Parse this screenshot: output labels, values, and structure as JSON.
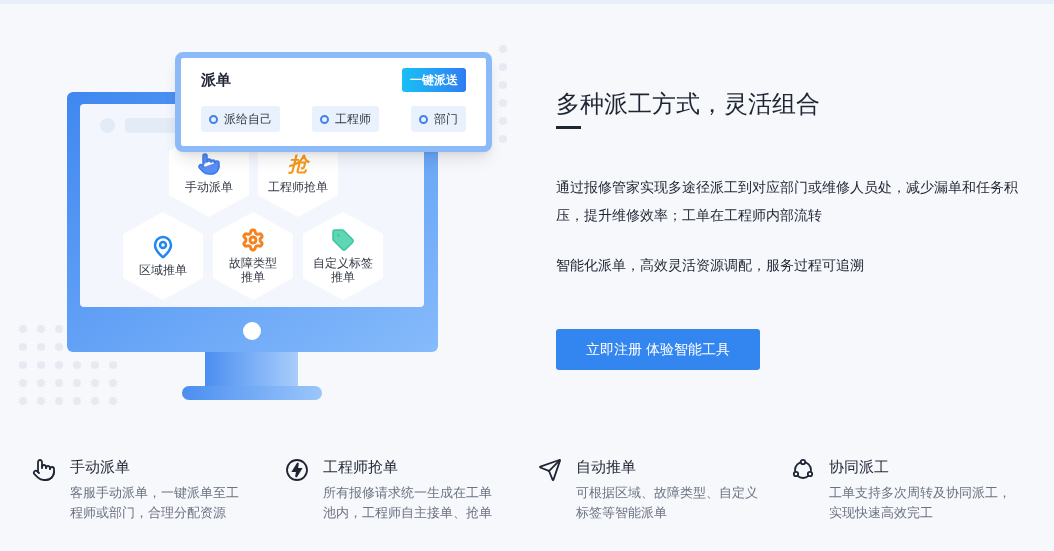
{
  "illustration": {
    "popup": {
      "title": "派单",
      "action": "一键派送",
      "options": [
        {
          "label": "派给自己"
        },
        {
          "label": "工程师"
        },
        {
          "label": "部门"
        }
      ]
    },
    "modes": [
      {
        "kind": "hand",
        "lines": [
          "手动派单"
        ]
      },
      {
        "kind": "glyph",
        "glyph": "抢",
        "lines": [
          "工程师抢单"
        ]
      },
      {
        "kind": "pin",
        "lines": [
          "区域推单"
        ]
      },
      {
        "kind": "gear",
        "lines": [
          "故障类型",
          "推单"
        ]
      },
      {
        "kind": "tag",
        "lines": [
          "自定义标签",
          "推单"
        ]
      }
    ]
  },
  "headline": "多种派工方式，灵活组合",
  "paragraphs": [
    "通过报修管家实现多途径派工到对应部门或维修人员处，减少漏单和任务积压，提升维修效率；工单在工程师内部流转",
    "智能化派单，高效灵活资源调配，服务过程可追溯"
  ],
  "cta": "立即注册 体验智能工具",
  "features": [
    {
      "kind": "hand",
      "title": "手动派单",
      "lines": [
        "客服手动派单，一键派单至工",
        "程师或部门，合理分配资源"
      ]
    },
    {
      "kind": "bolt",
      "title": "工程师抢单",
      "lines": [
        "所有报修请求统一生成在工单",
        "池内，工程师自主接单、抢单"
      ]
    },
    {
      "kind": "send",
      "title": "自动推单",
      "lines": [
        "可根据区域、故障类型、自定义",
        "标签等智能派单"
      ]
    },
    {
      "kind": "share",
      "title": "协同派工",
      "lines": [
        "工单支持多次周转及协同派工，",
        "实现快速高效完工"
      ]
    }
  ]
}
